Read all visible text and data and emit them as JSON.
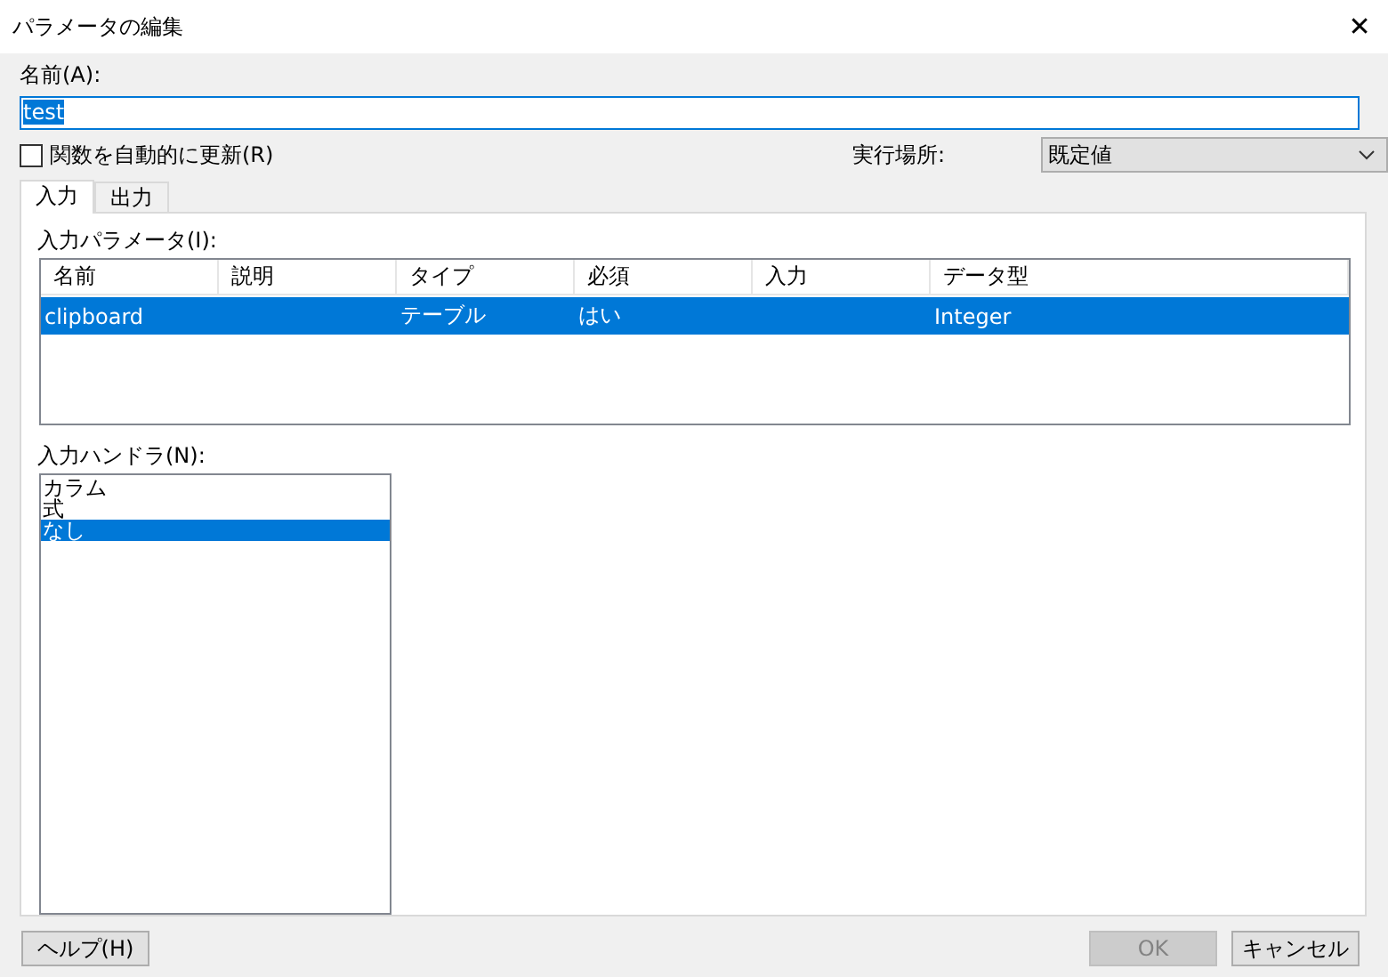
{
  "window": {
    "title": "パラメータの編集",
    "close": "✕"
  },
  "name_field": {
    "label": "名前(A):",
    "value": "test"
  },
  "auto_update": {
    "label": "関数を自動的に更新(R)",
    "checked": false
  },
  "location": {
    "label": "実行場所:",
    "value": "既定値"
  },
  "tabs": [
    {
      "label": "入力",
      "selected": true
    },
    {
      "label": "出力",
      "selected": false
    }
  ],
  "parameters": {
    "label": "入力パラメータ(I):",
    "columns": [
      "名前",
      "説明",
      "タイプ",
      "必須",
      "入力",
      "データ型"
    ],
    "rows": [
      {
        "cells": [
          "clipboard",
          "",
          "テーブル",
          "はい",
          "",
          "Integer"
        ],
        "selected": true
      }
    ]
  },
  "handlers": {
    "label": "入力ハンドラ(N):",
    "items": [
      {
        "label": "カラム",
        "selected": false
      },
      {
        "label": "式",
        "selected": false
      },
      {
        "label": "なし",
        "selected": true
      }
    ]
  },
  "buttons": [
    {
      "label": "ヘルプ(H)",
      "disabled": false,
      "kind": "help"
    },
    {
      "label": "OK",
      "disabled": true,
      "kind": "ok"
    },
    {
      "label": "キャンセル",
      "disabled": false,
      "kind": "cancel"
    }
  ]
}
